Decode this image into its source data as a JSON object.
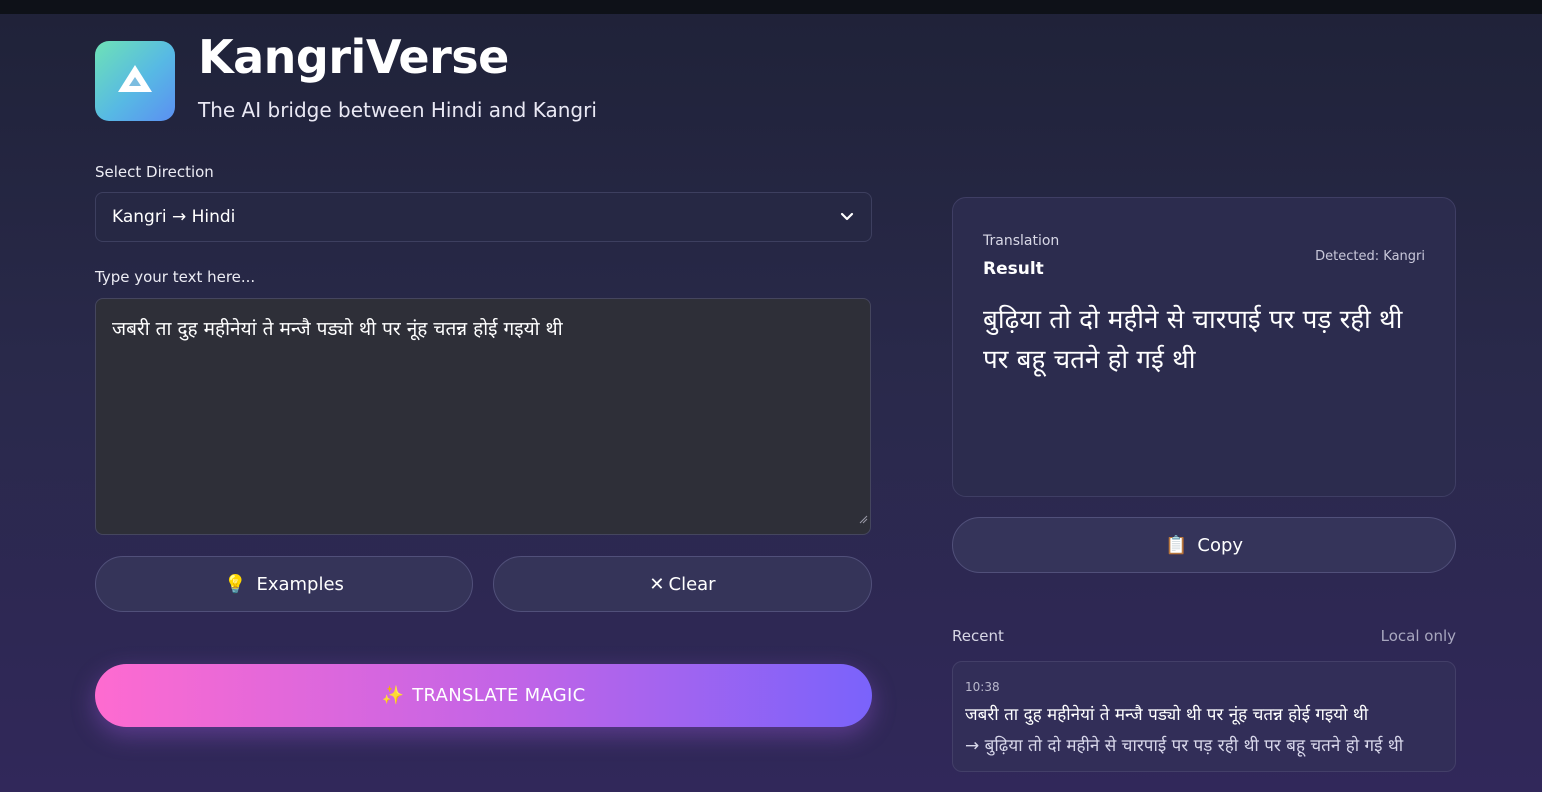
{
  "header": {
    "title": "KangriVerse",
    "subtitle": "The AI bridge between Hindi and Kangri",
    "logo_icon": "mountain-icon"
  },
  "direction": {
    "label": "Select Direction",
    "selected": "Kangri → Hindi"
  },
  "input": {
    "label": "Type your text here...",
    "value": "जबरी ता दुह महीनेयां ते मन्जै पड्यो थी पर नूंह चतन्न होई गइयो थी"
  },
  "actions": {
    "examples_label": "Examples",
    "examples_icon": "💡",
    "clear_label": "Clear",
    "clear_icon": "✕",
    "translate_label": "TRANSLATE MAGIC",
    "translate_icon": "✨"
  },
  "result": {
    "caption": "Translation",
    "heading": "Result",
    "detected": "Detected: Kangri",
    "text": "बुढ़िया तो दो महीने से चारपाई पर पड़ रही थी पर बहू चतने हो गई थी"
  },
  "copy": {
    "label": "Copy",
    "icon": "📋"
  },
  "recent": {
    "label": "Recent",
    "note": "Local only",
    "items": [
      {
        "time": "10:38",
        "source": "जबरी ता दुह महीनेयां ते मन्जै पड्यो थी पर नूंह चतन्न होई गइयो थी",
        "target": "→ बुढ़िया तो दो महीने से चारपाई पर पड़ रही थी पर बहू चतने हो गई थी"
      }
    ]
  },
  "colors": {
    "background_top": "#1f2238",
    "background_bottom": "#31285a",
    "button_gradient_start": "#fe6bd0",
    "button_gradient_end": "#7a63fb",
    "logo_gradient_start": "#6ee2b6",
    "logo_gradient_end": "#5b8ff2"
  }
}
